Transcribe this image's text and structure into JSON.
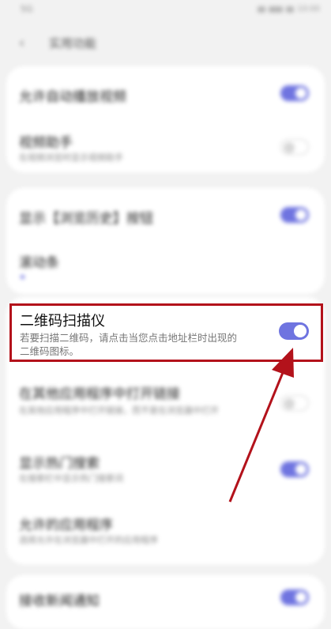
{
  "status_bar": {
    "signal": "5G",
    "time": "10:00"
  },
  "header": {
    "title": "实用功能"
  },
  "group1": [
    {
      "title": "允许自动播放视频",
      "desc": "",
      "state": "on"
    },
    {
      "title": "视频助手",
      "desc": "在视频浏览时显示视频助手",
      "state": "off"
    }
  ],
  "group2": [
    {
      "title": "显示【浏览历史】按钮",
      "desc": "",
      "state": "on"
    },
    {
      "title": "滚动条",
      "desc": "",
      "state": "dot"
    }
  ],
  "qr": {
    "title": "二维码扫描仪",
    "desc": "若要扫描二维码，请点击当您点击地址栏时出现的二维码图标。",
    "state": "on"
  },
  "group3": [
    {
      "title": "在其他应用程序中打开链接",
      "desc": "在其他应用程序中打开链接，而不是在浏览器中打开",
      "state": "off"
    },
    {
      "title": "显示热门搜索",
      "desc": "在搜索栏中显示热门搜索词",
      "state": "on"
    },
    {
      "title": "允许的应用程序",
      "desc": "选择允许在浏览器中打开的应用程序",
      "state": "none"
    }
  ],
  "group4": [
    {
      "title": "接收新闻通知",
      "desc": "",
      "state": "on"
    }
  ],
  "colors": {
    "accent": "#6f74e0",
    "highlight": "#b3121b",
    "background": "#f2f2f2"
  }
}
